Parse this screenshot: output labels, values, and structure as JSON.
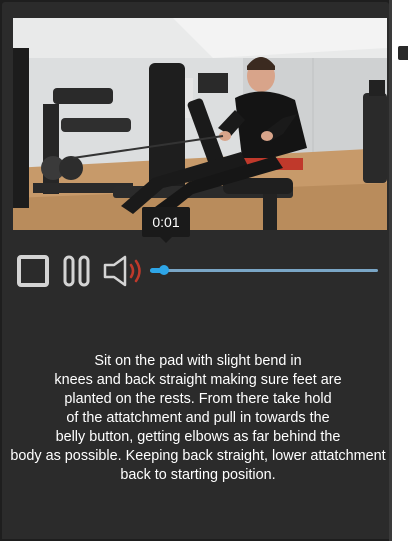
{
  "video": {
    "current_time_tooltip": "0:01",
    "progress_fraction": 0.06,
    "volume_state": "on"
  },
  "controls": {
    "stop_icon": "stop-icon",
    "pause_icon": "pause-icon",
    "volume_icon": "volume-icon"
  },
  "description": {
    "lines": [
      "Sit on the pad with slight bend in",
      "knees and back straight making sure feet are",
      "planted on the rests. From there take hold",
      "of the attatchment and pull in towards the",
      "belly button, getting elbows as far behind the",
      "body as possible. Keeping back straight, lower attatchment",
      "back to starting position."
    ]
  },
  "colors": {
    "panel_bg": "#2b2b2b",
    "seek_accent": "#2ea6e8",
    "seek_track": "#7aa6c6",
    "volume_wave": "#c0392b"
  }
}
